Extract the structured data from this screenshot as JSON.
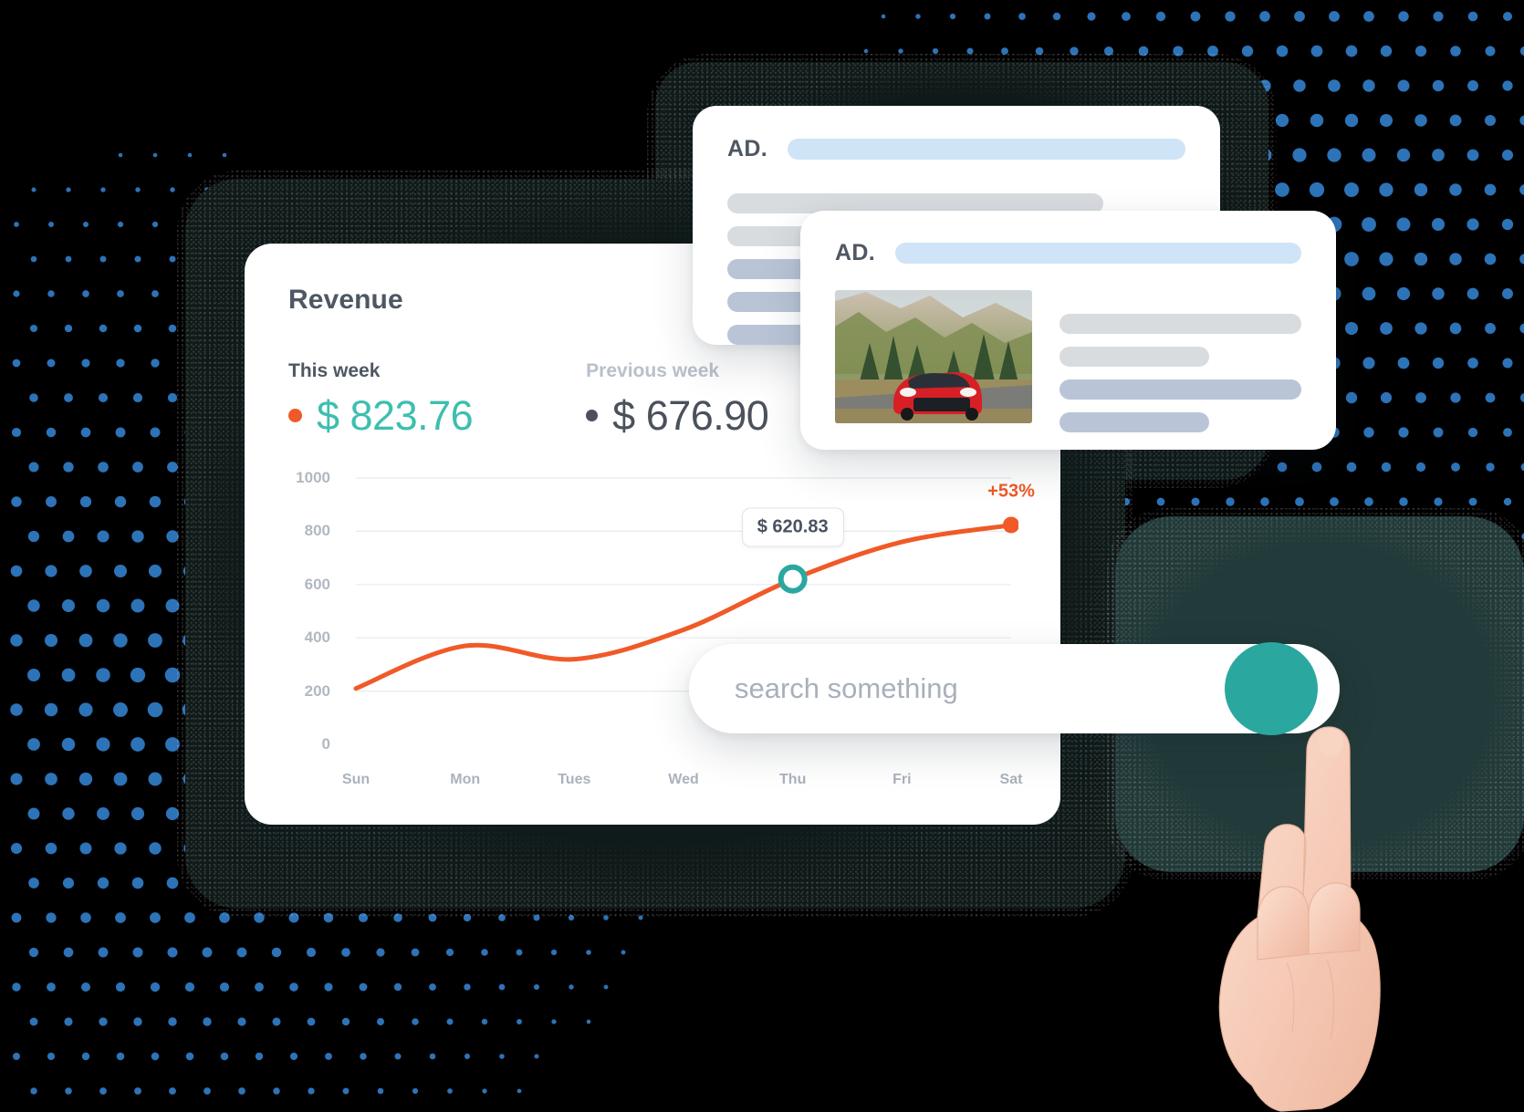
{
  "revenue_card": {
    "title": "Revenue",
    "stats": [
      {
        "label": "This week",
        "value": "$ 823.76",
        "color": "#3dbfae",
        "bullet": "#f05a28"
      },
      {
        "label": "Previous week",
        "value": "$ 676.90",
        "color": "#4b515c",
        "bullet": "#4b515c"
      }
    ],
    "tooltip": "$ 620.83",
    "growth_badge": "+53%"
  },
  "chart_data": {
    "type": "line",
    "title": "Revenue",
    "categories": [
      "Sun",
      "Mon",
      "Tues",
      "Wed",
      "Thu",
      "Fri",
      "Sat"
    ],
    "series": [
      {
        "name": "This week",
        "values": [
          210,
          370,
          320,
          430,
          620,
          760,
          823
        ],
        "color": "#f05a28"
      }
    ],
    "yticks": [
      "0",
      "200",
      "400",
      "600",
      "800",
      "1000"
    ],
    "ylim": [
      0,
      1000
    ],
    "xlabel": "",
    "ylabel": "",
    "grid": true,
    "legend": "none",
    "highlight_point": {
      "category": "Thu",
      "value": 620.83,
      "label": "$ 620.83",
      "color": "#2aa8a0"
    },
    "end_point": {
      "category": "Sat",
      "value": 823.76,
      "color": "#f05a28"
    },
    "annotation": "+53%"
  },
  "ad_cards": [
    {
      "label": "AD.",
      "headline_color": "#cfe4f6",
      "skeleton_rows": [
        {
          "width_pct": 82,
          "color": "#d8dcdf"
        },
        {
          "width_pct": 66,
          "color": "#d8dcdf"
        },
        {
          "width_pct": 66,
          "color": "#b9c5d7"
        },
        {
          "width_pct": 66,
          "color": "#b9c5d7"
        },
        {
          "width_pct": 66,
          "color": "#b9c5d7"
        }
      ]
    },
    {
      "label": "AD.",
      "headline_color": "#cfe4f6",
      "image_alt": "red-sports-car-on-mountain-road",
      "skeleton_rows": [
        {
          "width_pct": 100,
          "color": "#d8dcdf"
        },
        {
          "width_pct": 62,
          "color": "#d8dcdf"
        },
        {
          "width_pct": 100,
          "color": "#b9c5d7"
        },
        {
          "width_pct": 62,
          "color": "#b9c5d7"
        }
      ]
    }
  ],
  "search": {
    "placeholder": "search something",
    "value": "",
    "button_color": "#2aa8a0"
  },
  "colors": {
    "accent_orange": "#f05a28",
    "accent_teal": "#3dbfae",
    "button_teal": "#2aa8a0",
    "dot_blue": "#2d73b8",
    "frame_dark": "#101a19",
    "frame_teal": "#223a39",
    "text_dark": "#4e5763",
    "text_muted": "#b1b8c2"
  }
}
